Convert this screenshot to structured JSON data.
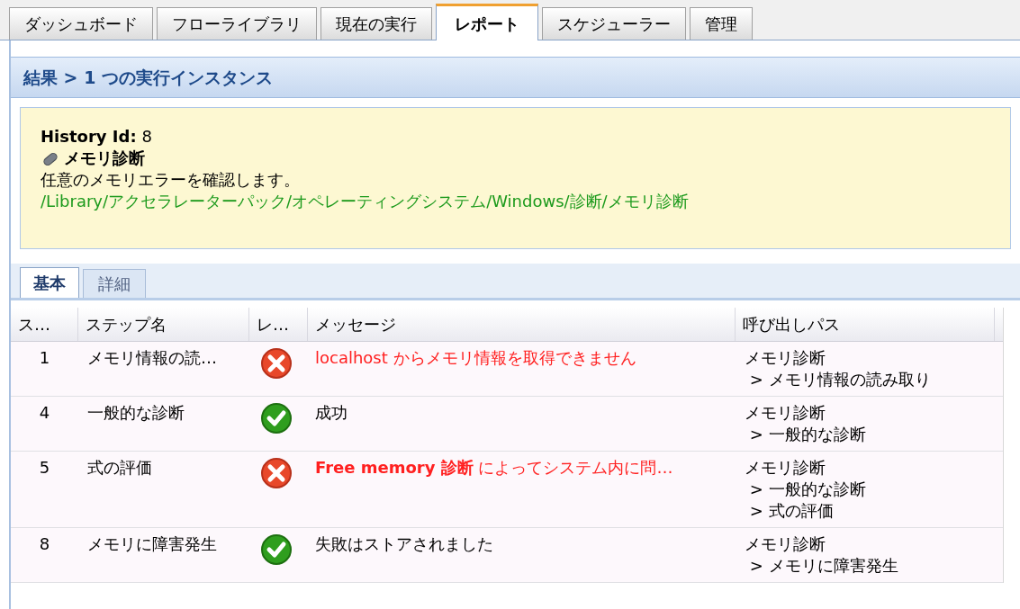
{
  "tabs": [
    {
      "label": "ダッシュボード",
      "selected": false
    },
    {
      "label": "フローライブラリ",
      "selected": false
    },
    {
      "label": "現在の実行",
      "selected": false
    },
    {
      "label": "レポート",
      "selected": true
    },
    {
      "label": "スケジューラー",
      "selected": false
    },
    {
      "label": "管理",
      "selected": false
    }
  ],
  "panel_title": "結果 > 1 つの実行インスタンス",
  "summary": {
    "history_label": "History Id:",
    "history_id": "8",
    "flow_name": "メモリ診断",
    "description": "任意のメモリエラーを確認します。",
    "path": "/Library/アクセラレーターパック/オペレーティングシステム/Windows/診断/メモリ診断"
  },
  "subtabs": [
    {
      "label": "基本",
      "selected": true
    },
    {
      "label": "詳細",
      "selected": false
    }
  ],
  "table": {
    "columns": [
      "ス…",
      "ステップ名",
      "レ…",
      "メッセージ",
      "呼び出しパス"
    ],
    "rows": [
      {
        "step": "1",
        "name": "メモリ情報の読…",
        "failed": true,
        "message": "localhost からメモリ情報を取得できません",
        "call_path": [
          "メモリ診断",
          " > メモリ情報の読み取り"
        ]
      },
      {
        "step": "4",
        "name": "一般的な診断",
        "failed": false,
        "message": "成功",
        "call_path": [
          "メモリ診断",
          " > 一般的な診断"
        ]
      },
      {
        "step": "5",
        "name": "式の評価",
        "failed": true,
        "message": "**Free memory 診断** によってシステム内に問…",
        "call_path": [
          "メモリ診断",
          " > 一般的な診断",
          " > 式の評価"
        ]
      },
      {
        "step": "8",
        "name": "メモリに障害発生",
        "failed": false,
        "message": "失敗はストアされました",
        "call_path": [
          "メモリ診断",
          " > メモリに障害発生"
        ]
      }
    ]
  }
}
